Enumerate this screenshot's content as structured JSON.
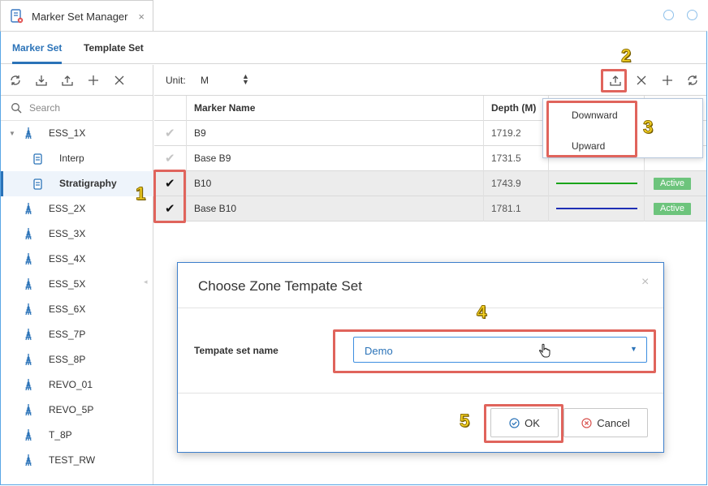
{
  "window": {
    "title": "Marker Set Manager",
    "close": "×"
  },
  "tabs": [
    {
      "label": "Marker Set"
    },
    {
      "label": "Template Set"
    }
  ],
  "left": {
    "search_placeholder": "Search",
    "tree": [
      {
        "label": "ESS_1X",
        "type": "well",
        "expanded": true
      },
      {
        "label": "Interp",
        "type": "doc"
      },
      {
        "label": "Stratigraphy",
        "type": "doc",
        "selected": true
      },
      {
        "label": "ESS_2X",
        "type": "well"
      },
      {
        "label": "ESS_3X",
        "type": "well"
      },
      {
        "label": "ESS_4X",
        "type": "well"
      },
      {
        "label": "ESS_5X",
        "type": "well"
      },
      {
        "label": "ESS_6X",
        "type": "well"
      },
      {
        "label": "ESS_7P",
        "type": "well"
      },
      {
        "label": "ESS_8P",
        "type": "well"
      },
      {
        "label": "REVO_01",
        "type": "well"
      },
      {
        "label": "REVO_5P",
        "type": "well"
      },
      {
        "label": "T_8P",
        "type": "well"
      },
      {
        "label": "TEST_RW",
        "type": "well"
      }
    ]
  },
  "right": {
    "unit_label": "Unit:",
    "unit_value": "M",
    "columns": [
      "",
      "Marker Name",
      "Depth (M)",
      "",
      ""
    ],
    "rows": [
      {
        "checked": false,
        "name": "B9",
        "depth": "1719.2",
        "color": "",
        "status": ""
      },
      {
        "checked": false,
        "name": "Base B9",
        "depth": "1731.5",
        "color": "",
        "status": ""
      },
      {
        "checked": true,
        "name": "B10",
        "depth": "1743.9",
        "color": "#1aa51a",
        "status": "Active"
      },
      {
        "checked": true,
        "name": "Base B10",
        "depth": "1781.1",
        "color": "#1f2fb5",
        "status": "Active"
      }
    ],
    "partial_text": "ˢ"
  },
  "export_menu": {
    "items": [
      "Downward",
      "Upward"
    ]
  },
  "dialog": {
    "title": "Choose Zone Tempate Set",
    "field_label": "Tempate set name",
    "field_value": "Demo",
    "ok_label": "OK",
    "cancel_label": "Cancel"
  },
  "callouts": [
    "1",
    "2",
    "3",
    "4",
    "5"
  ],
  "colors": {
    "accent": "#2b73b8",
    "annotation": "#e0645c",
    "active": "#6dc47c"
  }
}
